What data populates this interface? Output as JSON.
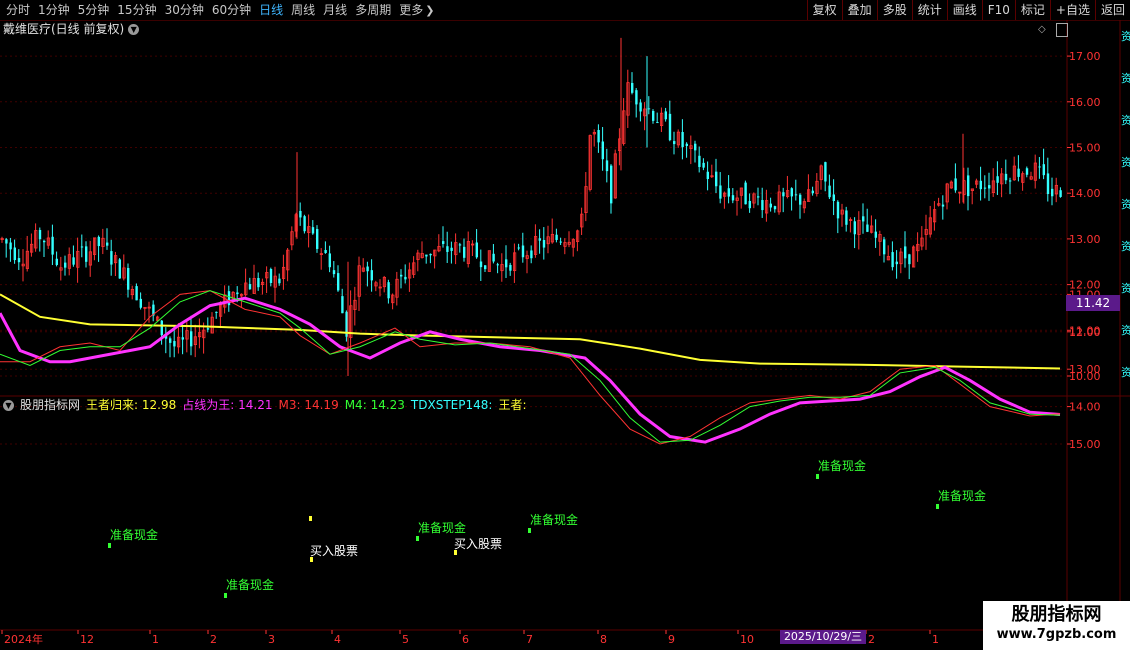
{
  "toolbar": {
    "periods": [
      "分时",
      "1分钟",
      "5分钟",
      "15分钟",
      "30分钟",
      "60分钟",
      "日线",
      "周线",
      "月线",
      "多周期",
      "更多"
    ],
    "active_period": "日线",
    "tools": [
      "复权",
      "叠加",
      "多股",
      "统计",
      "画线",
      "F10",
      "标记",
      "+自选",
      "返回"
    ]
  },
  "main_panel": {
    "title": "戴维医疗(日线 前复权)",
    "price_badge": "11.42",
    "y_ticks": [
      "17.00",
      "16.00",
      "15.00",
      "14.00",
      "13.00",
      "12.00",
      "11.00",
      "10.00"
    ]
  },
  "indicator_panel": {
    "name": "股朋指标网",
    "values": [
      {
        "label": "王者归来:",
        "value": "12.98",
        "color": "#ffff33"
      },
      {
        "label": "占线为王:",
        "value": "14.21",
        "color": "#ff33ff"
      },
      {
        "label": "M3:",
        "value": "14.19",
        "color": "#ff3333"
      },
      {
        "label": "M4:",
        "value": "14.23",
        "color": "#33ff33"
      },
      {
        "label": "TDXSTEP148:",
        "value": "",
        "color": "#33ffff"
      },
      {
        "label": "王者:",
        "value": "",
        "color": "#ffff33"
      }
    ],
    "y_ticks": [
      "15.00",
      "14.00",
      "13.00",
      "12.00",
      "11.00"
    ],
    "signals": {
      "prepare": "准备现金",
      "buy": "买入股票"
    }
  },
  "x_axis": {
    "labels": [
      "2024年",
      "12",
      "1",
      "2",
      "3",
      "4",
      "5",
      "6",
      "7",
      "8",
      "9",
      "10",
      "2025/10/29/三",
      "2",
      "1"
    ]
  },
  "side_text": "资",
  "watermark": {
    "line1": "股朋指标网",
    "line2": "www.7gpzb.com"
  },
  "colors": {
    "up": "#ff3333",
    "down": "#33ffff",
    "ma_slow": "#ffff33",
    "ma_fast": "#ff33ff",
    "m3": "#ff3333",
    "m4": "#33ff33",
    "grid": "#400000",
    "axis": "#5a0000"
  }
}
